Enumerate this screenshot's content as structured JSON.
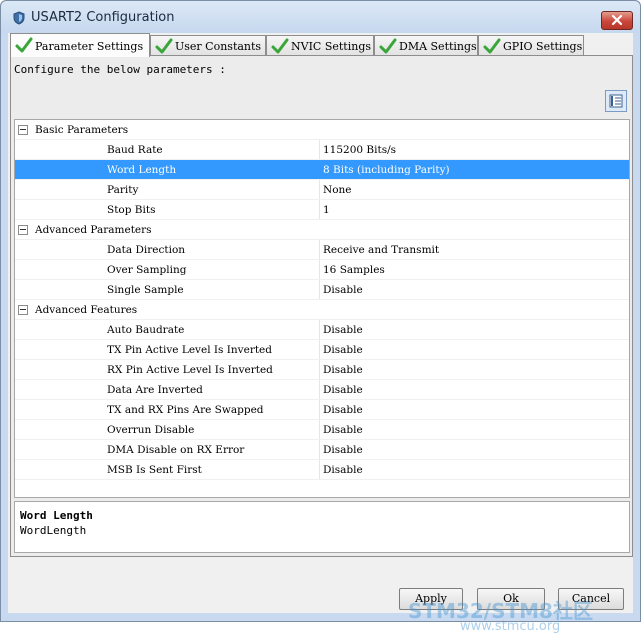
{
  "window": {
    "title": "USART2 Configuration"
  },
  "tabs": [
    {
      "label": "Parameter Settings"
    },
    {
      "label": "User Constants"
    },
    {
      "label": "NVIC Settings"
    },
    {
      "label": "DMA Settings"
    },
    {
      "label": "GPIO Settings"
    }
  ],
  "panel": {
    "configure_label": "Configure the below parameters :"
  },
  "groups": [
    {
      "name": "Basic Parameters",
      "params": [
        {
          "name": "Baud Rate",
          "value": "115200 Bits/s"
        },
        {
          "name": "Word Length",
          "value": "8 Bits (including Parity)"
        },
        {
          "name": "Parity",
          "value": "None"
        },
        {
          "name": "Stop Bits",
          "value": "1"
        }
      ]
    },
    {
      "name": "Advanced Parameters",
      "params": [
        {
          "name": "Data Direction",
          "value": "Receive and Transmit"
        },
        {
          "name": "Over Sampling",
          "value": "16 Samples"
        },
        {
          "name": "Single Sample",
          "value": "Disable"
        }
      ]
    },
    {
      "name": "Advanced Features",
      "params": [
        {
          "name": "Auto Baudrate",
          "value": "Disable"
        },
        {
          "name": "TX Pin Active Level Is Inverted",
          "value": "Disable"
        },
        {
          "name": "RX Pin Active Level Is Inverted",
          "value": "Disable"
        },
        {
          "name": "Data Are Inverted",
          "value": "Disable"
        },
        {
          "name": "TX and RX Pins Are Swapped",
          "value": "Disable"
        },
        {
          "name": "Overrun Disable",
          "value": "Disable"
        },
        {
          "name": "DMA Disable on RX Error",
          "value": "Disable"
        },
        {
          "name": "MSB Is Sent First",
          "value": "Disable"
        }
      ]
    }
  ],
  "description": {
    "title": "Word Length",
    "id": "WordLength"
  },
  "buttons": {
    "apply": "Apply",
    "ok": "Ok",
    "cancel": "Cancel"
  },
  "watermark": {
    "line1": "STM32/STM8社区",
    "line2": "www.stmcu.org"
  },
  "colors": {
    "selection": "#3399ff",
    "check": "#3aa63a",
    "close": "#c9473a"
  },
  "icons": {
    "app": "shield-icon",
    "close": "close-icon",
    "tab_status": "check-icon",
    "grid_toggle": "list-view-icon"
  }
}
